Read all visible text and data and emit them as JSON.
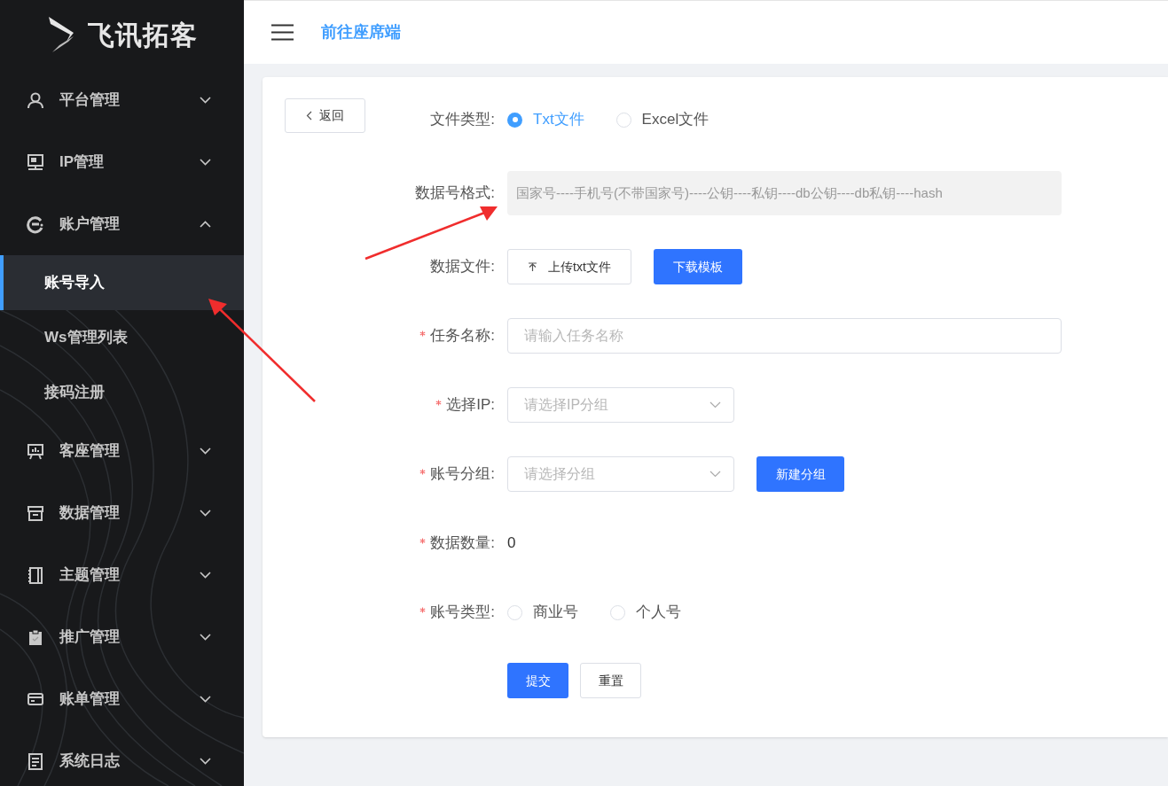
{
  "logo": {
    "text": "飞讯拓客"
  },
  "header": {
    "link": "前往座席端"
  },
  "sidebar": {
    "items": [
      {
        "label": "平台管理",
        "expanded": false
      },
      {
        "label": "IP管理",
        "expanded": false
      },
      {
        "label": "账户管理",
        "expanded": true,
        "children": [
          {
            "label": "账号导入",
            "selected": true
          },
          {
            "label": "Ws管理列表",
            "selected": false
          },
          {
            "label": "接码注册",
            "selected": false
          }
        ]
      },
      {
        "label": "客座管理",
        "expanded": false
      },
      {
        "label": "数据管理",
        "expanded": false
      },
      {
        "label": "主题管理",
        "expanded": false
      },
      {
        "label": "推广管理",
        "expanded": false
      },
      {
        "label": "账单管理",
        "expanded": false
      },
      {
        "label": "系统日志",
        "expanded": false
      }
    ]
  },
  "back_button": "返回",
  "form": {
    "fields": [
      {
        "kind": "radio",
        "label": "文件类型:",
        "required": false,
        "options": [
          {
            "label": "Txt文件",
            "selected": true
          },
          {
            "label": "Excel文件",
            "selected": false
          }
        ]
      },
      {
        "kind": "readonly",
        "label": "数据号格式:",
        "required": false,
        "value": "国家号----手机号(不带国家号)----公钥----私钥----db公钥----db私钥----hash"
      },
      {
        "kind": "upload",
        "label": "数据文件:",
        "required": false,
        "upload": "上传txt文件",
        "button": "下载模板"
      },
      {
        "kind": "input",
        "label": "任务名称:",
        "required": true,
        "placeholder": "请输入任务名称"
      },
      {
        "kind": "select",
        "label": "选择IP:",
        "required": true,
        "placeholder": "请选择IP分组"
      },
      {
        "kind": "select",
        "label": "账号分组:",
        "required": true,
        "placeholder": "请选择分组",
        "button": "新建分组"
      },
      {
        "kind": "count",
        "label": "数据数量:",
        "required": true,
        "value": "0"
      },
      {
        "kind": "radio",
        "label": "账号类型:",
        "required": true,
        "options": [
          {
            "label": "商业号",
            "selected": false
          },
          {
            "label": "个人号",
            "selected": false
          }
        ]
      }
    ],
    "actions": {
      "submit": "提交",
      "reset": "重置"
    }
  }
}
